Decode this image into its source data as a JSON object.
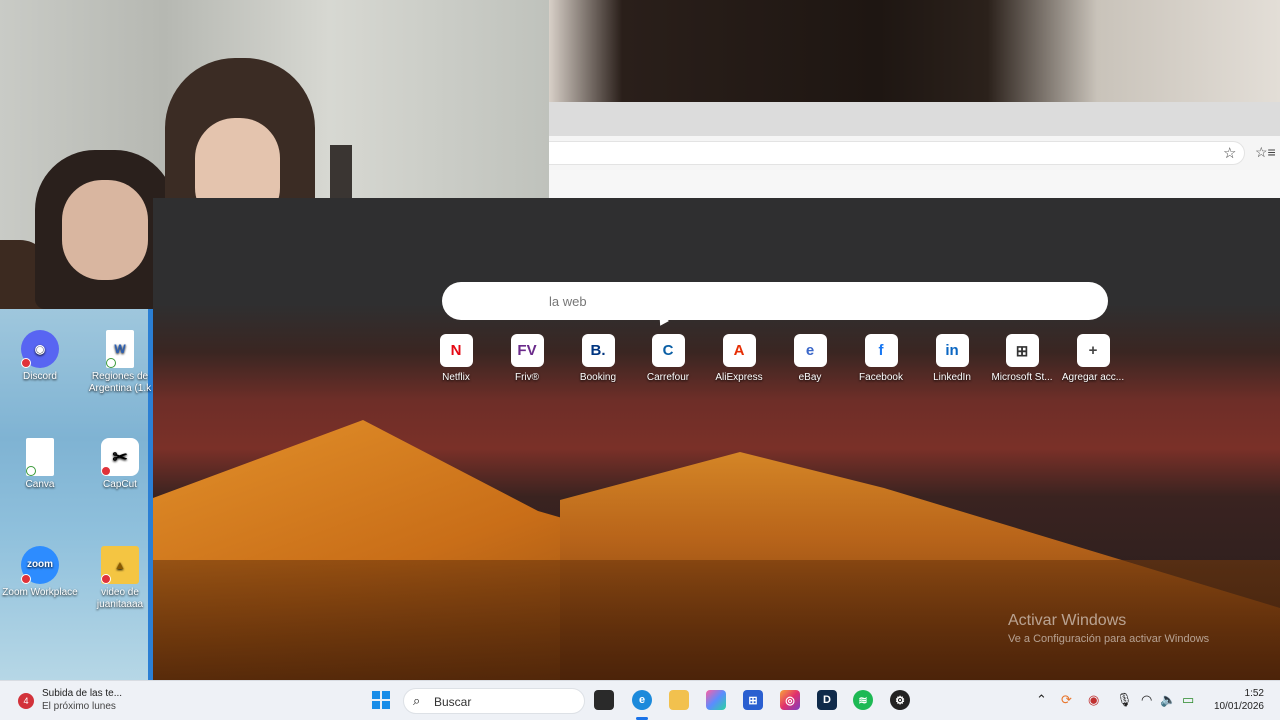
{
  "desktop": {
    "icons": [
      {
        "label": "Discord",
        "icon": "discord-icon",
        "color": "#5865f2"
      },
      {
        "label": "Regiones de Argentina (1.k",
        "icon": "word-doc-icon",
        "color": "#2b5fb3"
      },
      {
        "label": "Canva",
        "icon": "file-icon",
        "color": "#ffffff"
      },
      {
        "label": "CapCut",
        "icon": "capcut-icon",
        "color": "#000000"
      },
      {
        "label": "Zoom Workplace",
        "icon": "zoom-icon",
        "color": "#2d8cff"
      },
      {
        "label": "video de juanitaaaa",
        "icon": "folder-icon",
        "color": "#f4c542"
      }
    ]
  },
  "browser": {
    "search_placeholder": "la web",
    "star_icon": "star-icon",
    "favorites_icon": "favorites-icon",
    "tiles": [
      {
        "label": "Netflix",
        "glyph": "N",
        "color": "#e50914"
      },
      {
        "label": "Friv®",
        "glyph": "FV",
        "color": "#6a2a8a"
      },
      {
        "label": "Booking",
        "glyph": "B.",
        "color": "#003580"
      },
      {
        "label": "Carrefour",
        "glyph": "C",
        "color": "#0b5fa5"
      },
      {
        "label": "AliExpress",
        "glyph": "A",
        "color": "#e62e04"
      },
      {
        "label": "eBay",
        "glyph": "e",
        "color": "#3a67c9"
      },
      {
        "label": "Facebook",
        "glyph": "f",
        "color": "#1877f2"
      },
      {
        "label": "LinkedIn",
        "glyph": "in",
        "color": "#0a66c2"
      },
      {
        "label": "Microsoft St...",
        "glyph": "⊞",
        "color": "#333333"
      },
      {
        "label": "Agregar acc...",
        "glyph": "+",
        "color": "#444444"
      }
    ]
  },
  "watermark": {
    "title": "Activar Windows",
    "subtitle": "Ve a Configuración para activar Windows"
  },
  "taskbar": {
    "notification_count": "4",
    "weather_title": "Subida de las te...",
    "weather_sub": "El próximo lunes",
    "search_label": "Buscar",
    "time": "1:52",
    "date": "10/01/2026"
  }
}
